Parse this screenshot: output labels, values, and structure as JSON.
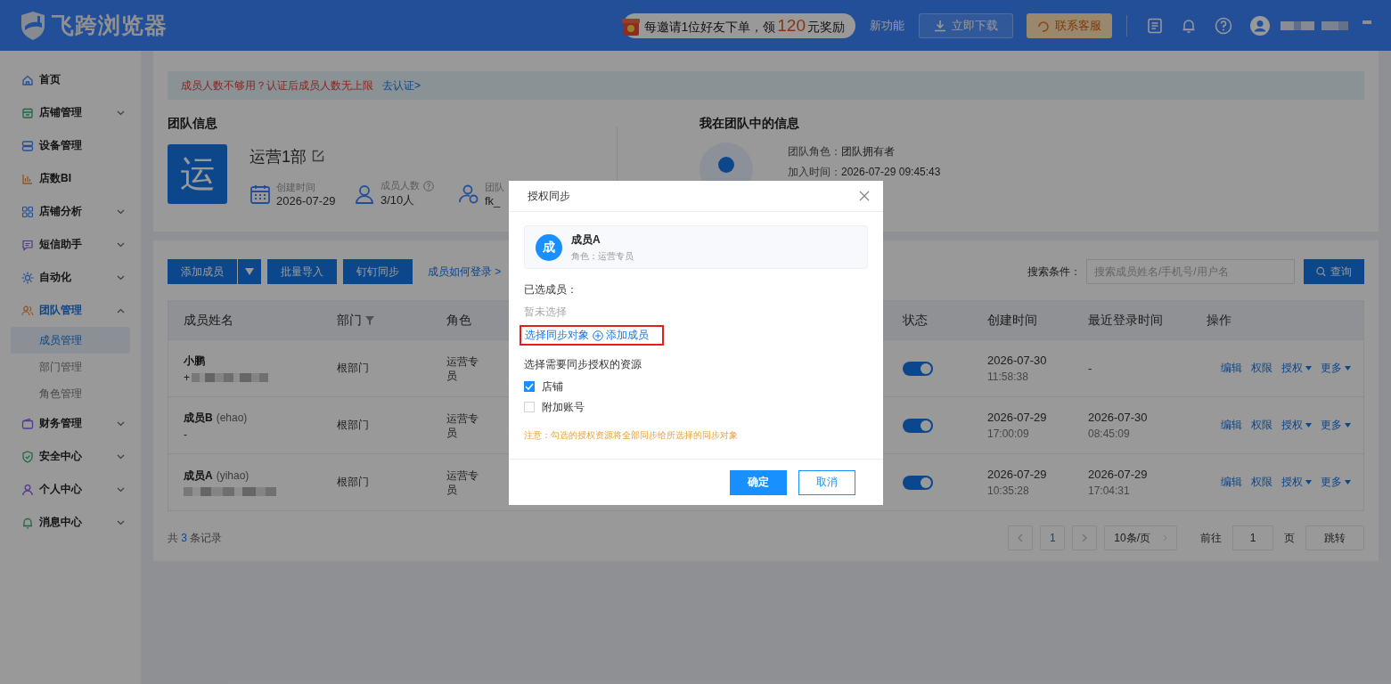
{
  "header": {
    "logo_text": "飞跨浏览器",
    "promo": {
      "before": "每邀请1位好友下单，领",
      "amount": "120",
      "after": "元奖励"
    },
    "new_feature": "新功能",
    "download": "立即下载",
    "support": "联系客服"
  },
  "sidebar": {
    "items": [
      {
        "label": "首页",
        "kind": "link",
        "selected": false
      },
      {
        "label": "店铺管理",
        "kind": "group",
        "expanded": false,
        "selected": false
      },
      {
        "label": "设备管理",
        "kind": "link",
        "selected": false
      },
      {
        "label": "店数BI",
        "kind": "link",
        "selected": false
      },
      {
        "label": "店铺分析",
        "kind": "group",
        "expanded": false,
        "selected": false
      },
      {
        "label": "短信助手",
        "kind": "group",
        "expanded": false,
        "selected": false
      },
      {
        "label": "自动化",
        "kind": "group",
        "expanded": false,
        "selected": false
      },
      {
        "label": "团队管理",
        "kind": "group",
        "expanded": true,
        "selected": true,
        "children": [
          {
            "label": "成员管理",
            "selected": true
          },
          {
            "label": "部门管理",
            "selected": false
          },
          {
            "label": "角色管理",
            "selected": false
          }
        ]
      },
      {
        "label": "财务管理",
        "kind": "group",
        "expanded": false,
        "selected": false
      },
      {
        "label": "安全中心",
        "kind": "group",
        "expanded": false,
        "selected": false
      },
      {
        "label": "个人中心",
        "kind": "group",
        "expanded": false,
        "selected": false
      },
      {
        "label": "消息中心",
        "kind": "group",
        "expanded": false,
        "selected": false
      }
    ]
  },
  "banner": {
    "message": "成员人数不够用？认证后成员人数无上限",
    "link": "去认证>"
  },
  "team_info": {
    "title": "团队信息",
    "avatar": "运",
    "name": "运营1部",
    "stats": [
      {
        "label": "创建时间",
        "value": "2026-07-29",
        "help": false
      },
      {
        "label": "成员人数",
        "value": "3/10人",
        "help": true
      },
      {
        "label": "团队",
        "value": "fk_",
        "help": false
      }
    ]
  },
  "my_info": {
    "title": "我在团队中的信息",
    "rows": [
      {
        "label": "团队角色：",
        "value": "团队拥有者"
      },
      {
        "label": "加入时间：",
        "value": "2026-07-29 09:45:43"
      }
    ]
  },
  "toolbar": {
    "add": "添加成员",
    "buttons": [
      "批量导入",
      "钉钉同步"
    ],
    "help_link": "成员如何登录 >",
    "search_label": "搜索条件：",
    "search_placeholder": "搜索成员姓名/手机号/用户名",
    "query": "查询"
  },
  "table": {
    "columns": [
      {
        "label": "成员姓名",
        "filter": false
      },
      {
        "label": "部门",
        "filter": true
      },
      {
        "label": "角色",
        "filter": false
      },
      {
        "label": "状态",
        "filter": false
      },
      {
        "label": "创建时间",
        "filter": false
      },
      {
        "label": "最近登录时间",
        "filter": false
      },
      {
        "label": "操作",
        "filter": false
      }
    ],
    "rows": [
      {
        "name": "小鹏",
        "contact": "+",
        "contact_blurred": true,
        "department": "根部门",
        "role": "运营专员",
        "enabled": true,
        "created_date": "2026-07-30",
        "created_time": "11:58:38",
        "last_login_date": "-",
        "actions": [
          {
            "label": "编辑",
            "dropdown": false
          },
          {
            "label": "权限",
            "dropdown": false
          },
          {
            "label": "授权",
            "dropdown": true
          },
          {
            "label": "更多",
            "dropdown": true
          }
        ]
      },
      {
        "name": "成员B",
        "username": "(ehao)",
        "contact": "-",
        "contact_blurred": false,
        "department": "根部门",
        "role": "运营专员",
        "enabled": true,
        "created_date": "2026-07-29",
        "created_time": "17:00:09",
        "last_login_date": "2026-07-30",
        "last_login_time": "08:45:09",
        "actions": [
          {
            "label": "编辑",
            "dropdown": false
          },
          {
            "label": "权限",
            "dropdown": false
          },
          {
            "label": "授权",
            "dropdown": true
          },
          {
            "label": "更多",
            "dropdown": true
          }
        ]
      },
      {
        "name": "成员A",
        "username": "(yihao)",
        "contact_blurred": true,
        "department": "根部门",
        "role": "运营专员",
        "enabled": true,
        "created_date": "2026-07-29",
        "created_time": "10:35:28",
        "last_login_date": "2026-07-29",
        "last_login_time": "17:04:31",
        "actions": [
          {
            "label": "编辑",
            "dropdown": false
          },
          {
            "label": "权限",
            "dropdown": false
          },
          {
            "label": "授权",
            "dropdown": true
          },
          {
            "label": "更多",
            "dropdown": true
          }
        ]
      }
    ]
  },
  "pagination": {
    "total_before": "共",
    "total": "3",
    "total_after": "条记录",
    "page": "1",
    "page_size": "10条/页",
    "goto": "前往",
    "goto_value": "1",
    "page_unit": "页",
    "jump": "跳转"
  },
  "modal": {
    "title": "授权同步",
    "member": {
      "avatar": "成",
      "name": "成员A",
      "role": "角色：运营专员"
    },
    "selected_label": "已选成员：",
    "selected_empty": "暂未选择",
    "select_target": "选择同步对象",
    "add_member": "添加成员",
    "highlighted": true,
    "resources_label": "选择需要同步授权的资源",
    "options": [
      {
        "label": "店铺",
        "checked": true
      },
      {
        "label": "附加账号",
        "checked": false
      }
    ],
    "note": "注意：勾选的授权资源将全部同步给所选择的同步对象",
    "ok": "确定",
    "cancel": "取消"
  }
}
